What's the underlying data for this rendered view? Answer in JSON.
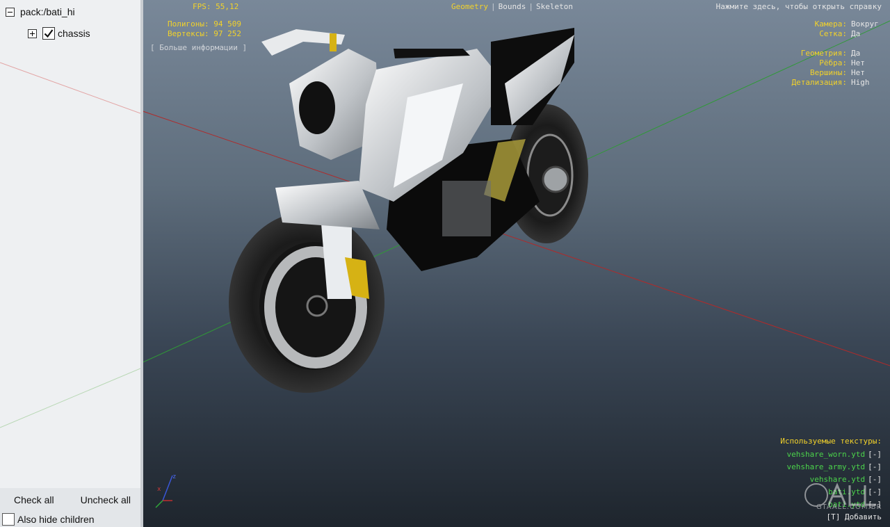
{
  "tree": {
    "root": {
      "label": "pack:/bati_hi",
      "expanded": true
    },
    "children": [
      {
        "label": "chassis",
        "checked": true,
        "expanded": false
      }
    ]
  },
  "buttons": {
    "check_all": "Check all",
    "uncheck_all": "Uncheck all"
  },
  "options": {
    "also_hide_children": {
      "label": "Also hide children",
      "checked": false
    }
  },
  "hud": {
    "fps": "FPS: 55,12",
    "polygons": "Полигоны: 94 509",
    "vertices": "Вертексы: 97 252",
    "more_info": "[ Больше информации ]",
    "tabs": [
      "Geometry",
      "Bounds",
      "Skeleton"
    ],
    "active_tab": "Geometry",
    "help": "Нажмите здесь, чтобы открыть справку",
    "settings": [
      {
        "key": "Камера:",
        "value": "Вокруг"
      },
      {
        "key": "Сетка:",
        "value": "Да"
      },
      {
        "key": "Геометрия:",
        "value": "Да"
      },
      {
        "key": "Рёбра:",
        "value": "Нет"
      },
      {
        "key": "Вершины:",
        "value": "Нет"
      },
      {
        "key": "Детализация:",
        "value": "High"
      }
    ],
    "textures_title": "Используемые текстуры:",
    "textures": [
      {
        "name": "vehshare_worn.ytd",
        "action": "[-]"
      },
      {
        "name": "vehshare_army.ytd",
        "action": "[-]"
      },
      {
        "name": "vehshare.ytd",
        "action": "[-]"
      },
      {
        "name": "bati.ytd",
        "action": "[-]"
      },
      {
        "name": "bati.ytd",
        "action": "[-]"
      }
    ],
    "add_hint": "[T] Добавить"
  },
  "gizmo": {
    "x": "x",
    "z": "z"
  },
  "watermark": "GTAALL.COM.BR",
  "colors": {
    "hud_yellow": "#f2d22a",
    "hud_green": "#4bd34b",
    "axis_red": "#b02a2a",
    "axis_green": "#2f9a36"
  }
}
